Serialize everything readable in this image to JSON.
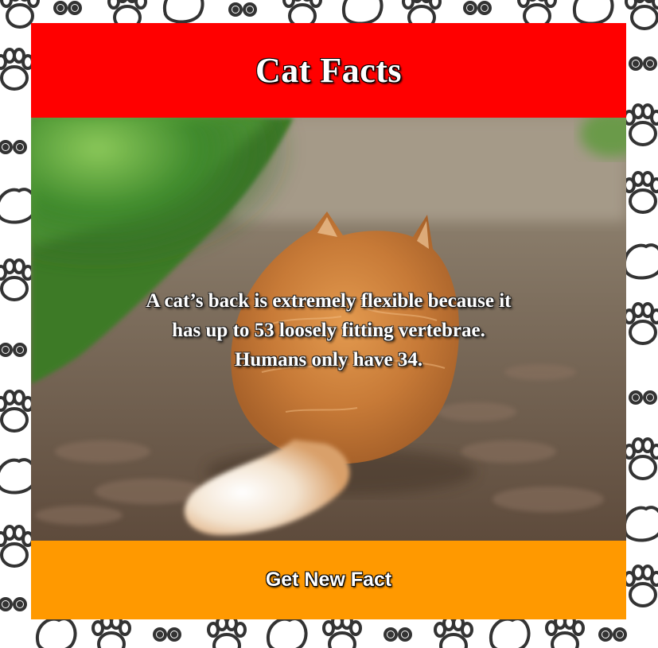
{
  "header": {
    "title": "Cat Facts"
  },
  "fact": {
    "text": "A cat’s back is extremely flexible because it has up to 53 loosely fitting vertebrae. Humans only have 34."
  },
  "footer": {
    "button_label": "Get New Fact"
  },
  "colors": {
    "header_bg": "#ff0000",
    "footer_bg": "#ff9900",
    "text": "#ffffff",
    "pattern_stroke": "#333333"
  },
  "icons": {
    "background_pattern": "cat-paw-doodle-icon"
  }
}
